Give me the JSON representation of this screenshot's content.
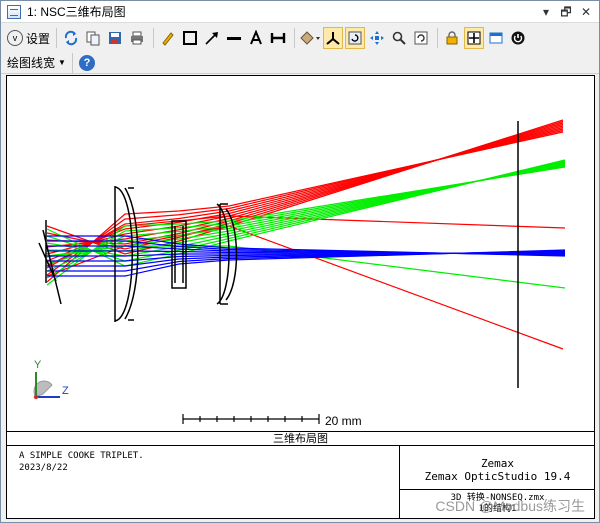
{
  "window": {
    "title": "1: NSC三维布局图"
  },
  "window_controls": {
    "pin": "▾",
    "restore": "🗗",
    "close": "✕"
  },
  "toolbar": {
    "settings_label": "设置",
    "line_width_label": "绘图线宽",
    "icons": [
      "refresh-icon",
      "copy-icon",
      "save-icon",
      "print-icon",
      "pencil-icon",
      "rectangle-icon",
      "arrow-icon",
      "line-icon",
      "text-icon",
      "dimension-icon",
      "rotate-view-icon",
      "axes-icon",
      "reset-rotation-icon",
      "pan-icon",
      "zoom-icon",
      "undo-icon",
      "lock-icon",
      "fit-icon",
      "window-icon",
      "power-icon"
    ]
  },
  "plot": {
    "scale_label": "20 mm",
    "axis_y": "Y",
    "axis_z": "Z",
    "title": "三维布局图",
    "description_line1": "A SIMPLE COOKE TRIPLET.",
    "description_line2": "2023/8/22",
    "company": "Zemax",
    "product": "Zemax OpticStudio 19.4",
    "file_line1": "3D 转换-NONSEQ.zmx",
    "file_line2": "1的结构1",
    "colors": {
      "red": "#ff0000",
      "green": "#00ee00",
      "blue": "#0000ff"
    }
  },
  "watermark": "CSDN @Modbus练习生"
}
